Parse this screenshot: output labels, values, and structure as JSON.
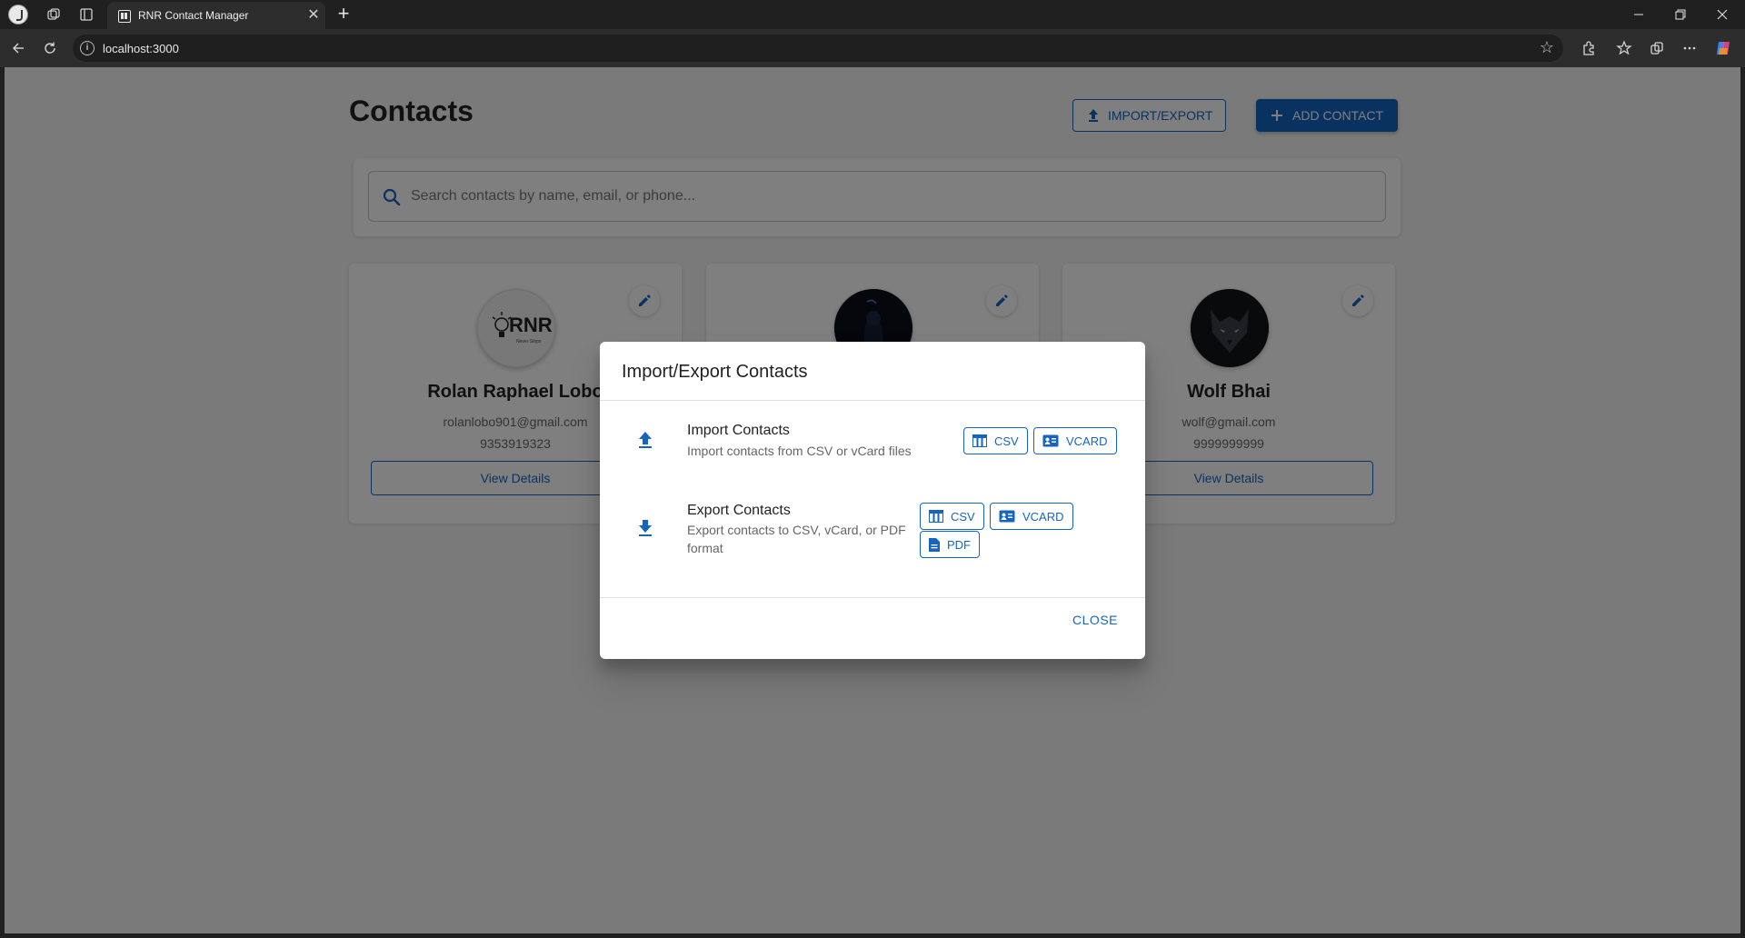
{
  "browser": {
    "tab_title": "RNR Contact Manager",
    "url": "localhost:3000"
  },
  "page": {
    "title": "Contacts",
    "import_export_label": "IMPORT/EXPORT",
    "add_contact_label": "ADD CONTACT",
    "search_placeholder": "Search contacts by name, email, or phone..."
  },
  "contacts": [
    {
      "name": "Rolan Raphael Lobo",
      "email": "rolanlobo901@gmail.com",
      "phone": "9353919323",
      "view_label": "View Details",
      "avatar_text": "RNR",
      "avatar_subtext": "Never Stops"
    },
    {
      "name": "",
      "email": "",
      "phone": "",
      "view_label": ""
    },
    {
      "name": "Wolf Bhai",
      "email": "wolf@gmail.com",
      "phone": "9999999999",
      "view_label": "View Details"
    }
  ],
  "dialog": {
    "title": "Import/Export Contacts",
    "import": {
      "title": "Import Contacts",
      "description": "Import contacts from CSV or vCard files",
      "csv_label": "CSV",
      "vcard_label": "VCARD"
    },
    "export": {
      "title": "Export Contacts",
      "description": "Export contacts to CSV, vCard, or PDF format",
      "csv_label": "CSV",
      "vcard_label": "VCARD",
      "pdf_label": "PDF"
    },
    "close_label": "CLOSE"
  },
  "colors": {
    "primary": "#1565c0",
    "backdrop": "rgba(0,0,0,0.5)"
  }
}
